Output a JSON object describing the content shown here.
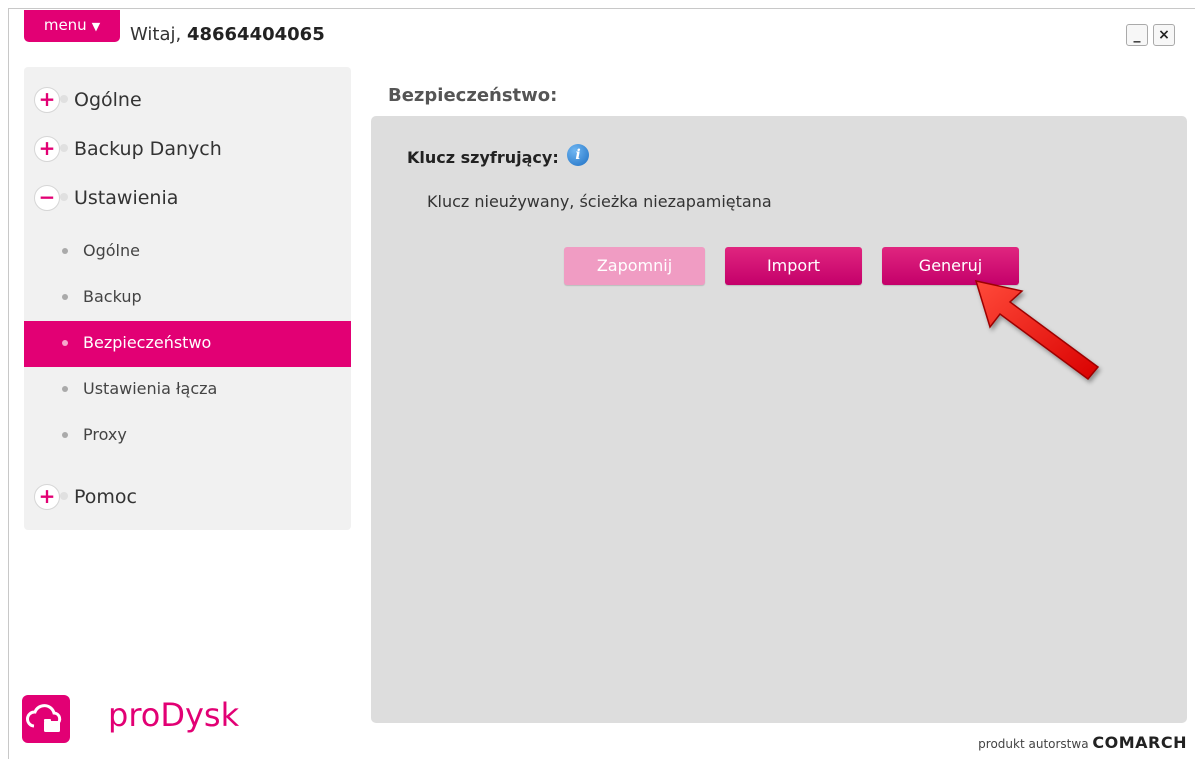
{
  "header": {
    "menu_label": "menu",
    "greeting_prefix": "Witaj,",
    "user_id": "48664404065",
    "minimize_label": "_",
    "close_label": "×"
  },
  "sidebar": {
    "categories": [
      {
        "label": "Ogólne",
        "symbol": "+"
      },
      {
        "label": "Backup Danych",
        "symbol": "+"
      },
      {
        "label": "Ustawienia",
        "symbol": "−"
      },
      {
        "label": "Pomoc",
        "symbol": "+"
      }
    ],
    "subitems": [
      {
        "label": "Ogólne"
      },
      {
        "label": "Backup"
      },
      {
        "label": "Bezpieczeństwo",
        "active": true
      },
      {
        "label": "Ustawienia łącza"
      },
      {
        "label": "Proxy"
      }
    ]
  },
  "main": {
    "title": "Bezpieczeństwo:",
    "key_title": "Klucz szyfrujący:",
    "info_icon_glyph": "i",
    "key_status": "Klucz nieużywany, ścieżka niezapamiętana",
    "buttons": {
      "forget": "Zapomnij",
      "import": "Import",
      "generate": "Generuj"
    }
  },
  "brand": {
    "app_name": "proDysk",
    "footer_prefix": "produkt autorstwa",
    "footer_brand": "COMARCH",
    "accent_color": "#e20074"
  },
  "icons": [
    "chevron-down-icon",
    "minimize-icon",
    "close-icon",
    "expand-icon",
    "collapse-icon",
    "info-icon",
    "cloud-logo-icon",
    "red-arrow-annotation"
  ]
}
